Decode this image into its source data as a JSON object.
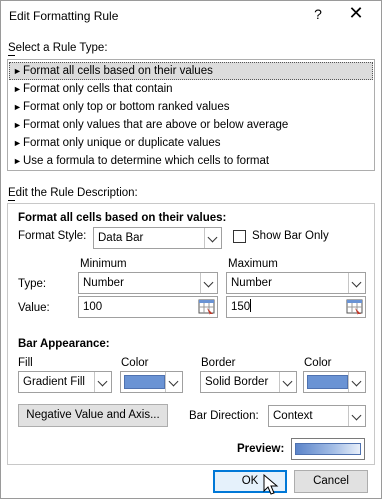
{
  "window": {
    "title": "Edit Formatting Rule",
    "help_label": "?",
    "close_label": "✕"
  },
  "rule_type": {
    "label": "Select a Rule Type:",
    "items": [
      {
        "label": "Format all cells based on their values",
        "selected": true
      },
      {
        "label": "Format only cells that contain",
        "selected": false
      },
      {
        "label": "Format only top or bottom ranked values",
        "selected": false
      },
      {
        "label": "Format only values that are above or below average",
        "selected": false
      },
      {
        "label": "Format only unique or duplicate values",
        "selected": false
      },
      {
        "label": "Use a formula to determine which cells to format",
        "selected": false
      }
    ]
  },
  "description": {
    "label": "Edit the Rule Description:",
    "heading": "Format all cells based on their values:",
    "format_style_label": "Format Style:",
    "format_style_value": "Data Bar",
    "show_bar_only_label": "Show Bar Only",
    "show_bar_only_checked": false,
    "minimum_label": "Minimum",
    "maximum_label": "Maximum",
    "type_label": "Type:",
    "value_label": "Value:",
    "min_type": "Number",
    "max_type": "Number",
    "min_value": "100",
    "max_value": "150"
  },
  "bar_appearance": {
    "heading": "Bar Appearance:",
    "fill_label": "Fill",
    "fill_color_label": "Color",
    "border_label": "Border",
    "border_color_label": "Color",
    "fill_value": "Gradient Fill",
    "border_value": "Solid Border",
    "fill_color": "#6a93d4",
    "border_color": "#6a93d4",
    "negative_button_label": "Negative Value and Axis...",
    "bar_direction_label": "Bar Direction:",
    "bar_direction_value": "Context",
    "preview_label": "Preview:"
  },
  "buttons": {
    "ok_label": "OK",
    "cancel_label": "Cancel"
  }
}
